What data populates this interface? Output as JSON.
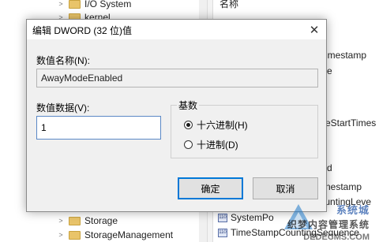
{
  "background": {
    "tree_items": [
      {
        "label": "I/O System",
        "expanded": false
      },
      {
        "label": "kernel",
        "expanded": false
      },
      {
        "label": "Storage",
        "expanded": false
      },
      {
        "label": "StorageManagement",
        "expanded": false
      }
    ],
    "list_header": "名称",
    "list_items": [
      "imestamp",
      "e",
      "eStartTimes",
      "d",
      "nestamp",
      "CountingLeve",
      "SystemPo",
      "TimeStampCountingSequence"
    ]
  },
  "dialog": {
    "title": "编辑 DWORD (32 位)值",
    "close_glyph": "✕",
    "value_name_label": "数值名称(N):",
    "value_name": "AwayModeEnabled",
    "value_data_label": "数值数据(V):",
    "value_data": "1",
    "base_label": "基数",
    "base_options": [
      {
        "label": "十六进制(H)",
        "checked": true
      },
      {
        "label": "十进制(D)",
        "checked": false
      }
    ],
    "ok_label": "确定",
    "cancel_label": "取消"
  },
  "watermark": {
    "line1": "系统城",
    "line2": "织梦内容管理系统",
    "line3": "DEDECMS.COM"
  },
  "colors": {
    "dialog_bg": "#f0f0f0",
    "focus_border": "#0078d7",
    "folder": "#e9c46a"
  }
}
